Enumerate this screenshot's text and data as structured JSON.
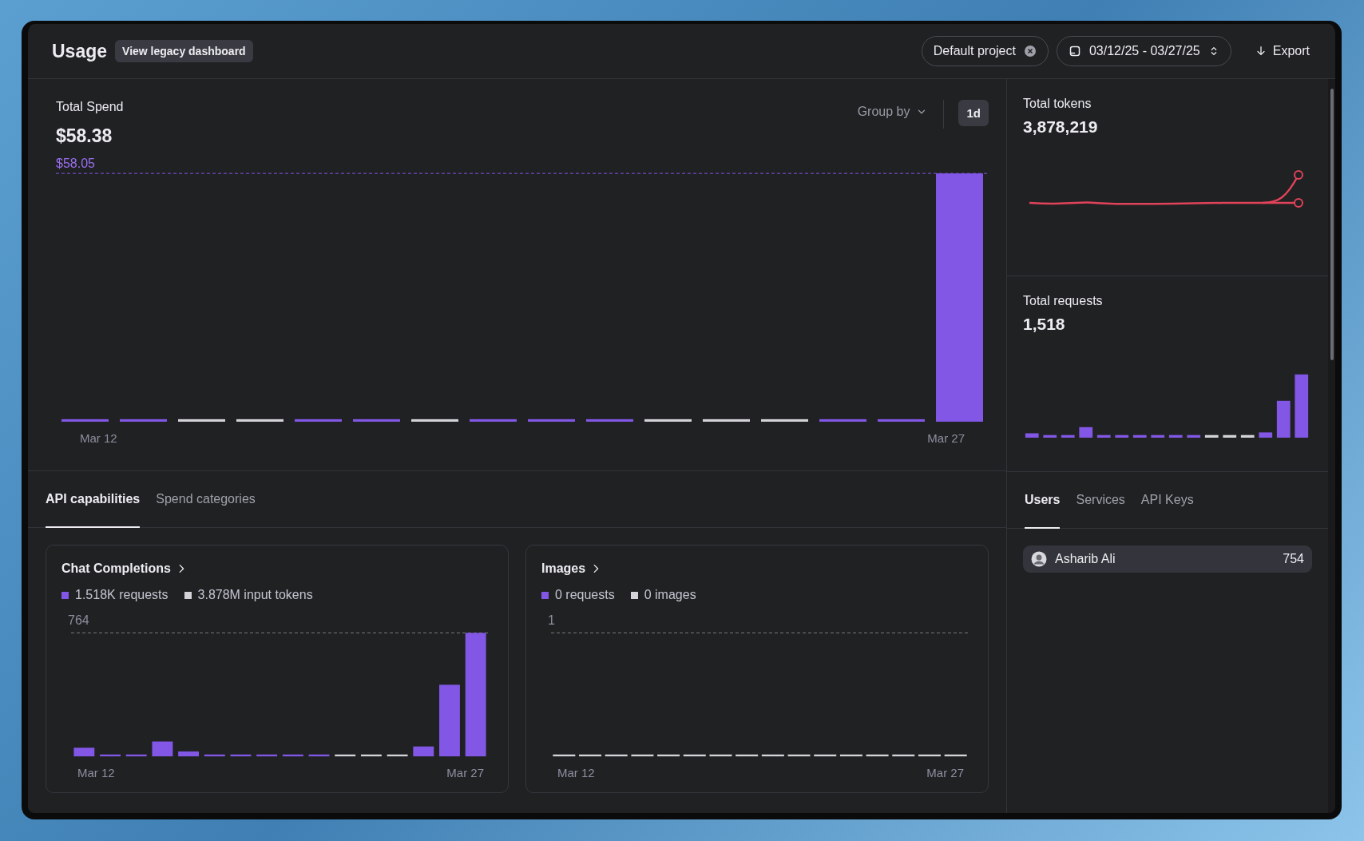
{
  "header": {
    "title": "Usage",
    "legacy_link": "View legacy dashboard",
    "project_chip": "Default project",
    "date_range": "03/12/25 - 03/27/25",
    "export": "Export"
  },
  "spend": {
    "label": "Total Spend",
    "value": "$58.38",
    "group_by": "Group by",
    "interval": "1d",
    "max_label": "$58.05",
    "x_start": "Mar 12",
    "x_end": "Mar 27"
  },
  "tokens": {
    "label": "Total tokens",
    "value": "3,878,219"
  },
  "requests": {
    "label": "Total requests",
    "value": "1,518"
  },
  "tabs": [
    {
      "label": "API capabilities",
      "selected": true
    },
    {
      "label": "Spend categories",
      "selected": false
    }
  ],
  "side_tabs": [
    {
      "label": "Users",
      "selected": true
    },
    {
      "label": "Services",
      "selected": false
    },
    {
      "label": "API Keys",
      "selected": false
    }
  ],
  "cards": [
    {
      "title": "Chat Completions",
      "legend": [
        {
          "label": "1.518K requests",
          "color": "#8257e5"
        },
        {
          "label": "3.878M input tokens",
          "color": "#d4d4d8"
        }
      ],
      "max_label": "764",
      "x_start": "Mar 12",
      "x_end": "Mar 27",
      "kind": "activity"
    },
    {
      "title": "Images",
      "legend": [
        {
          "label": "0 requests",
          "color": "#8257e5"
        },
        {
          "label": "0 images",
          "color": "#d4d4d8"
        }
      ],
      "max_label": "1",
      "x_start": "Mar 12",
      "x_end": "Mar 27",
      "kind": "empty"
    }
  ],
  "users": [
    {
      "name": "Asharib Ali",
      "count": "754"
    }
  ]
}
